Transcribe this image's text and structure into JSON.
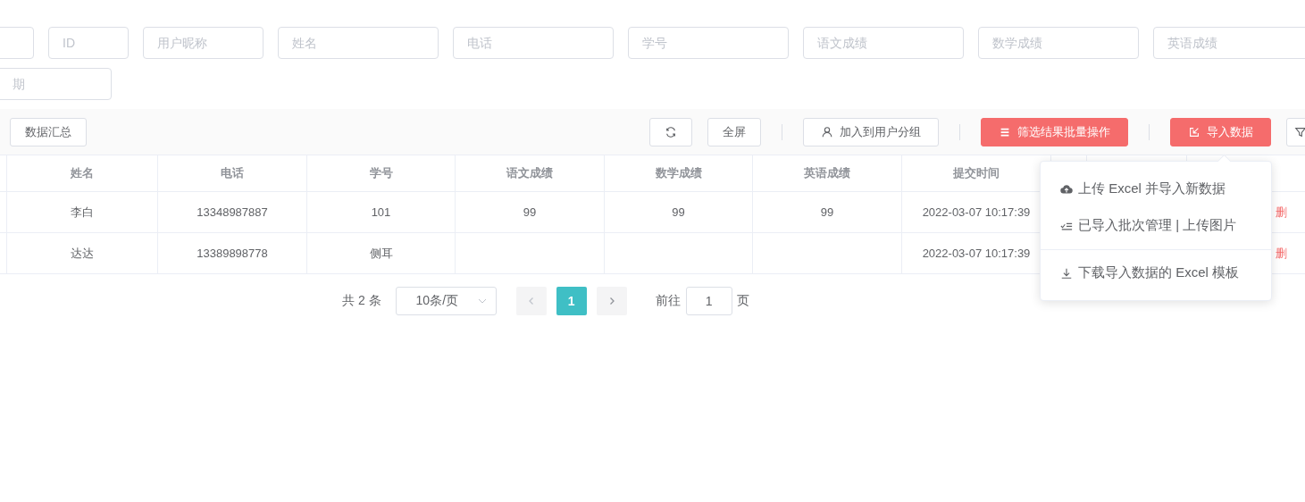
{
  "filters": [
    {
      "placeholder": "ID"
    },
    {
      "placeholder": "用户昵称"
    },
    {
      "placeholder": "姓名"
    },
    {
      "placeholder": "电话"
    },
    {
      "placeholder": "学号"
    },
    {
      "placeholder": "语文成绩"
    },
    {
      "placeholder": "数学成绩"
    },
    {
      "placeholder": "英语成绩"
    }
  ],
  "filters_row2": [
    {
      "placeholder": "期"
    }
  ],
  "toolbar": {
    "left": [
      {
        "label": "数据汇总"
      }
    ],
    "right": [
      {
        "kind": "icon"
      },
      {
        "kind": "plain",
        "label": "全屏"
      },
      {
        "kind": "divider"
      },
      {
        "kind": "plain",
        "label": "加入到用户分组"
      },
      {
        "kind": "divider"
      },
      {
        "kind": "danger",
        "label": "筛选结果批量操作"
      },
      {
        "kind": "divider"
      },
      {
        "kind": "danger",
        "label": "导入数据"
      },
      {
        "kind": "icon"
      }
    ]
  },
  "table": {
    "columns": [
      "",
      "姓名",
      "电话",
      "学号",
      "语文成绩",
      "数学成绩",
      "英语成绩",
      "提交时间",
      "",
      "",
      ""
    ],
    "rows": [
      {
        "cells": [
          "",
          "李白",
          "13348987887",
          "101",
          "99",
          "99",
          "99",
          "2022-03-07 10:17:39",
          "",
          "",
          "删"
        ]
      },
      {
        "cells": [
          "",
          "达达",
          "13389898778",
          "侧耳",
          "",
          "",
          "",
          "2022-03-07 10:17:39",
          "",
          "",
          "删"
        ]
      }
    ]
  },
  "pagination": {
    "total": "共 2 条",
    "page_size": "10条/页",
    "pages": [
      {
        "label": "1",
        "selected": true
      }
    ],
    "goto_label": "前往",
    "goto_value": "1",
    "goto_suffix": "页"
  },
  "dropdown": {
    "groups": [
      [
        "上传 Excel 并导入新数据",
        "已导入批次管理 | 上传图片"
      ],
      [
        "下载导入数据的 Excel 模板"
      ]
    ]
  }
}
